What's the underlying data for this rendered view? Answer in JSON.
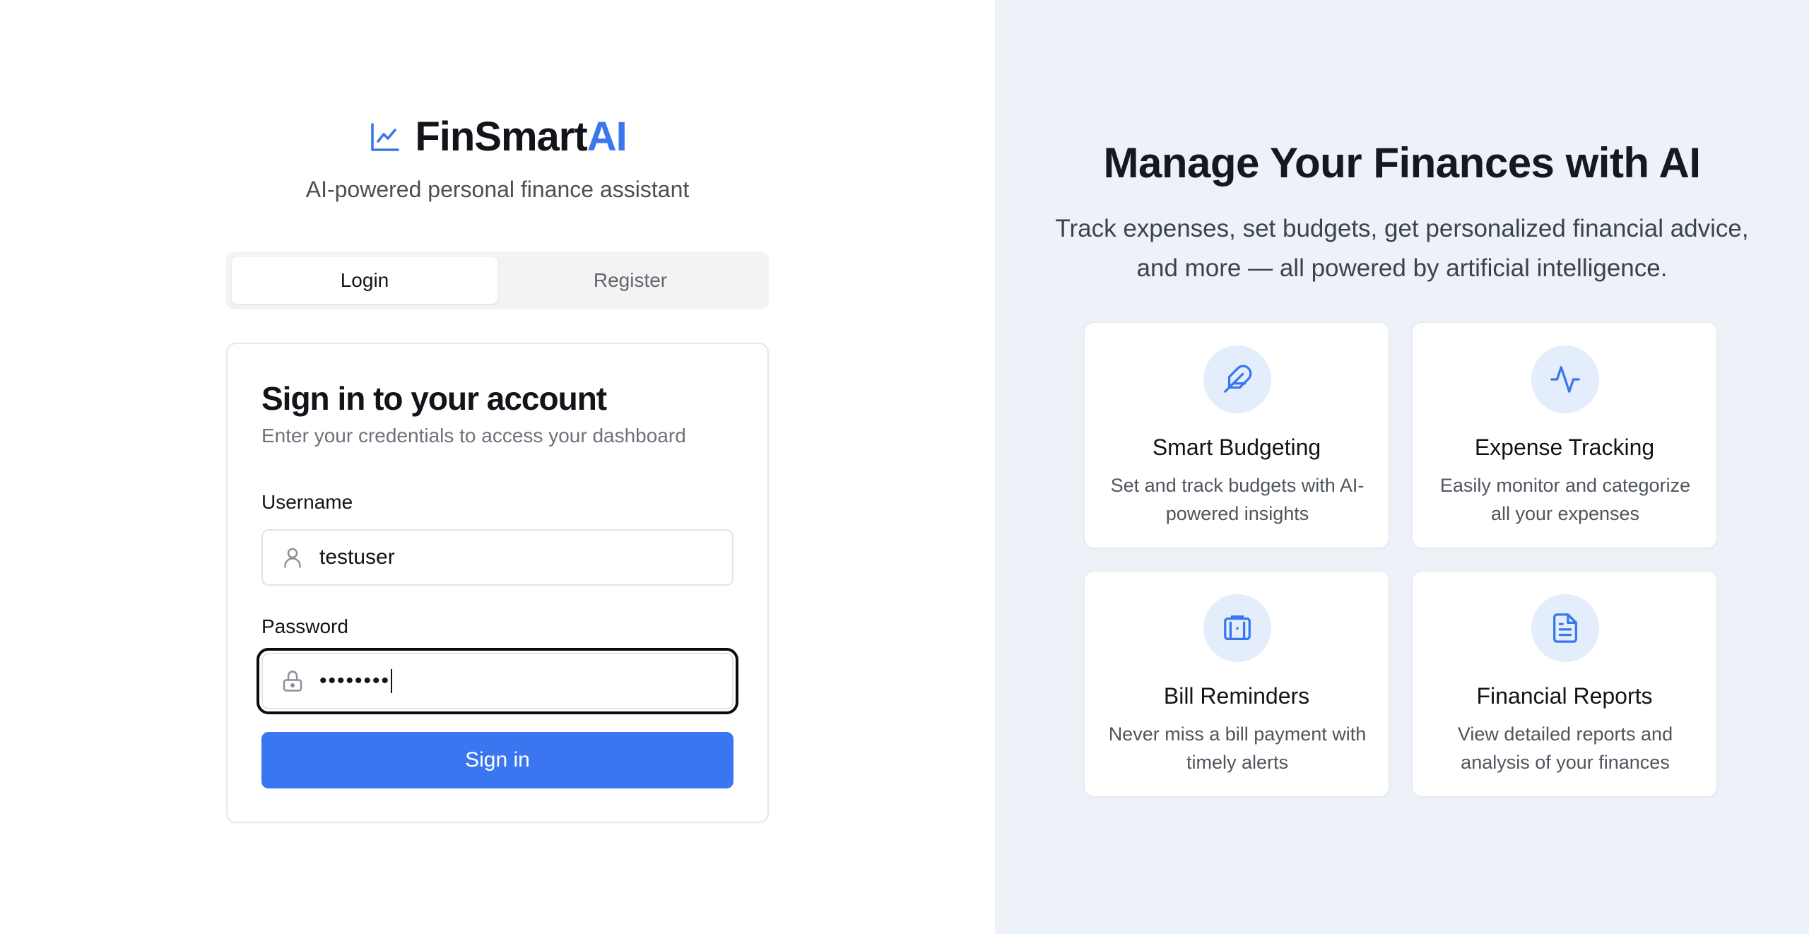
{
  "brand": {
    "name_main": "FinSmart",
    "name_accent": "AI",
    "icon": "line-chart-icon",
    "tagline": "AI-powered personal finance assistant"
  },
  "tabs": [
    {
      "label": "Login",
      "active": true
    },
    {
      "label": "Register",
      "active": false
    }
  ],
  "login": {
    "title": "Sign in to your account",
    "subtitle": "Enter your credentials to access your dashboard",
    "username_label": "Username",
    "username_value": "testuser",
    "username_icon": "user-icon",
    "password_label": "Password",
    "password_masked": "••••••••",
    "password_icon": "lock-icon",
    "submit_label": "Sign in"
  },
  "promo": {
    "title": "Manage Your Finances with AI",
    "subtitle": "Track expenses, set budgets, get personalized financial advice, and more — all powered by artificial intelligence.",
    "features": [
      {
        "icon": "feather-icon",
        "title": "Smart Budgeting",
        "description": "Set and track budgets with AI-powered insights"
      },
      {
        "icon": "activity-icon",
        "title": "Expense Tracking",
        "description": "Easily monitor and categorize all your expenses"
      },
      {
        "icon": "briefcase-icon",
        "title": "Bill Reminders",
        "description": "Never miss a bill payment with timely alerts"
      },
      {
        "icon": "file-text-icon",
        "title": "Financial Reports",
        "description": "View detailed reports and analysis of your finances"
      }
    ]
  },
  "colors": {
    "accent": "#3a76ec",
    "right_panel_bg": "#edf2f9",
    "icon_circle_bg": "#e4edfc"
  }
}
